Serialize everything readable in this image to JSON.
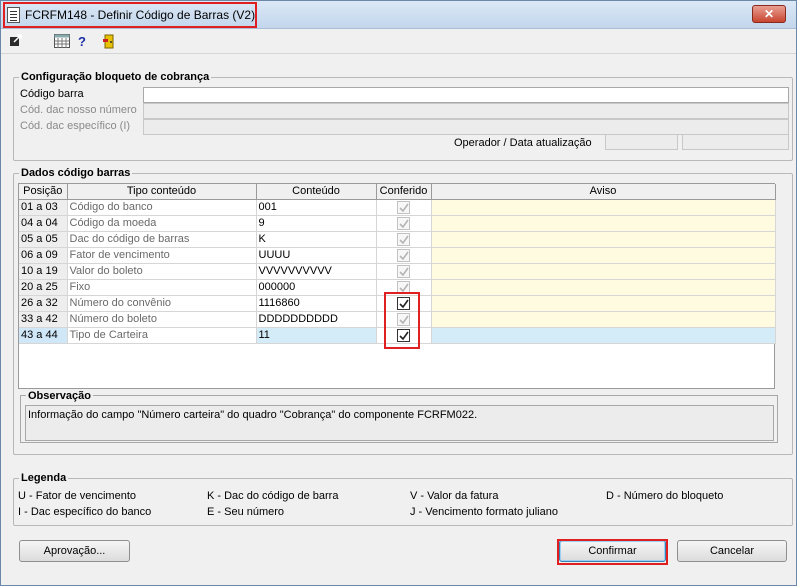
{
  "window": {
    "title": "FCRFM148 - Definir Código de Barras (V2)",
    "close_label": "✕"
  },
  "toolbar": {
    "icons": [
      "export-icon",
      "calculator-icon",
      "help-icon",
      "exit-door-icon"
    ],
    "help_label": "?"
  },
  "config": {
    "title": "Configuração bloqueto de cobrança",
    "codigo_barra_label": "Código barra",
    "codigo_barra_value": "",
    "dac_nosso_label": "Cód. dac nosso número",
    "dac_especifico_label": "Cód. dac específico (I)",
    "operador_label": "Operador / Data atualização"
  },
  "dados": {
    "title": "Dados código barras",
    "columns": [
      "Posição",
      "Tipo conteúdo",
      "Conteúdo",
      "Conferido",
      "Aviso"
    ],
    "rows": [
      {
        "pos": "01 a 03",
        "tipo": "Código do banco",
        "conteudo": "001",
        "conferido": "disabled",
        "aviso": ""
      },
      {
        "pos": "04 a 04",
        "tipo": "Código da moeda",
        "conteudo": "9",
        "conferido": "disabled",
        "aviso": ""
      },
      {
        "pos": "05 a 05",
        "tipo": "Dac do código de barras",
        "conteudo": "K",
        "conferido": "disabled",
        "aviso": ""
      },
      {
        "pos": "06 a 09",
        "tipo": "Fator de vencimento",
        "conteudo": "UUUU",
        "conferido": "disabled",
        "aviso": ""
      },
      {
        "pos": "10 a 19",
        "tipo": "Valor do boleto",
        "conteudo": "VVVVVVVVVV",
        "conferido": "disabled",
        "aviso": ""
      },
      {
        "pos": "20 a 25",
        "tipo": "Fixo",
        "conteudo": "000000",
        "conferido": "disabled",
        "aviso": ""
      },
      {
        "pos": "26 a 32",
        "tipo": "Número do convênio",
        "conteudo": "1116860",
        "conferido": "checked",
        "aviso": ""
      },
      {
        "pos": "33 a 42",
        "tipo": "Número do boleto",
        "conteudo": "DDDDDDDDDD",
        "conferido": "disabled",
        "aviso": ""
      },
      {
        "pos": "43 a 44",
        "tipo": "Tipo de Carteira",
        "conteudo": "11",
        "conferido": "checked",
        "aviso": "",
        "selected": true
      }
    ]
  },
  "observacao": {
    "title": "Observação",
    "text": "Informação do campo \"Número carteira\" do quadro \"Cobrança\" do componente FCRFM022."
  },
  "legenda": {
    "title": "Legenda",
    "items": [
      "U - Fator de vencimento",
      "K - Dac do código de barra",
      "V - Valor da fatura",
      "D - Número do bloqueto",
      "I - Dac específico do banco",
      "E - Seu número",
      "J - Vencimento formato juliano"
    ]
  },
  "buttons": {
    "aprovacao": "Aprovação...",
    "confirmar": "Confirmar",
    "cancelar": "Cancelar"
  }
}
